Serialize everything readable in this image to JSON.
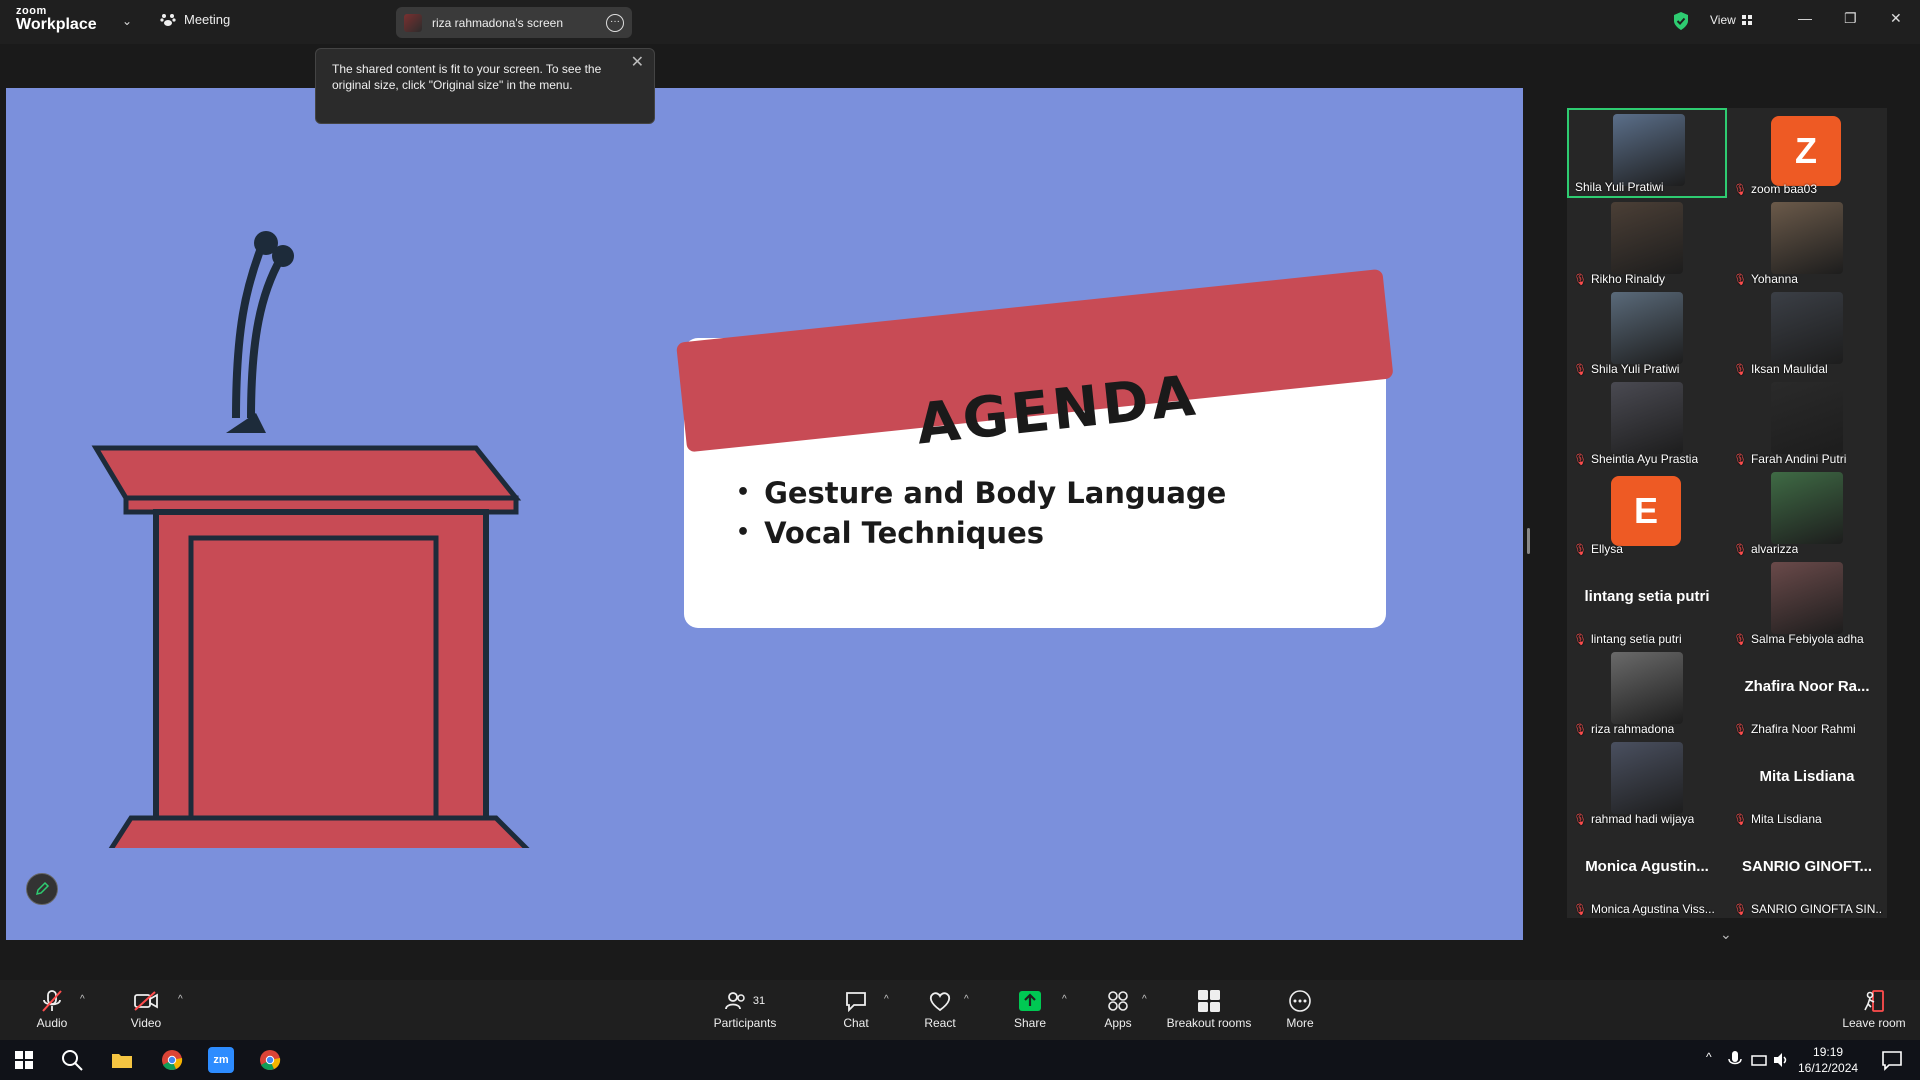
{
  "app": {
    "logo_top": "zoom",
    "logo_bottom": "Workplace",
    "meeting_label": "Meeting",
    "screen_title": "riza rahmadona's screen",
    "view_label": "View"
  },
  "tooltip": {
    "text": "The shared content is fit to your screen. To see the original size, click \"Original size\" in the menu."
  },
  "slide": {
    "title": "AGENDA",
    "items": [
      "Gesture and Body Language",
      "Vocal Techniques"
    ]
  },
  "participants": [
    {
      "name": "Shila Yuli Pratiwi",
      "kind": "video",
      "active": true
    },
    {
      "name": "zoom baa03",
      "kind": "letter",
      "letter": "Z"
    },
    {
      "name": "Rikho Rinaldy",
      "kind": "video"
    },
    {
      "name": "Yohanna",
      "kind": "video"
    },
    {
      "name": "Shila Yuli Pratiwi",
      "kind": "video"
    },
    {
      "name": "Iksan Maulidal",
      "kind": "video"
    },
    {
      "name": "Sheintia Ayu Prastia",
      "kind": "video"
    },
    {
      "name": "Farah Andini Putri",
      "kind": "video"
    },
    {
      "name": "Ellysa",
      "kind": "letter",
      "letter": "E"
    },
    {
      "name": "alvarizza",
      "kind": "video"
    },
    {
      "name": "lintang setia putri",
      "kind": "name",
      "display": "lintang setia putri"
    },
    {
      "name": "Salma Febiyola adha",
      "kind": "video"
    },
    {
      "name": "riza rahmadona",
      "kind": "video"
    },
    {
      "name": "Zhafira Noor Rahmi",
      "kind": "name",
      "display": "Zhafira Noor Ra..."
    },
    {
      "name": "rahmad hadi wijaya",
      "kind": "video"
    },
    {
      "name": "Mita Lisdiana",
      "kind": "name",
      "display": "Mita Lisdiana"
    },
    {
      "name": "Monica Agustina Viss...",
      "kind": "name",
      "display": "Monica  Agustin..."
    },
    {
      "name": "SANRIO GINOFTA SIN...",
      "kind": "name",
      "display": "SANRIO GINOFT..."
    }
  ],
  "toolbar": {
    "audio": "Audio",
    "video": "Video",
    "participants": "Participants",
    "participants_count": "31",
    "chat": "Chat",
    "react": "React",
    "share": "Share",
    "apps": "Apps",
    "breakout": "Breakout rooms",
    "more": "More",
    "leave": "Leave room"
  },
  "taskbar": {
    "time": "19:19",
    "date": "16/12/2024"
  },
  "colors": {
    "slide_bg": "#7b90dc",
    "banner": "#c84b55",
    "active_border": "#2ecc71",
    "muted": "#ff4d4d",
    "share_green": "#00c853"
  }
}
